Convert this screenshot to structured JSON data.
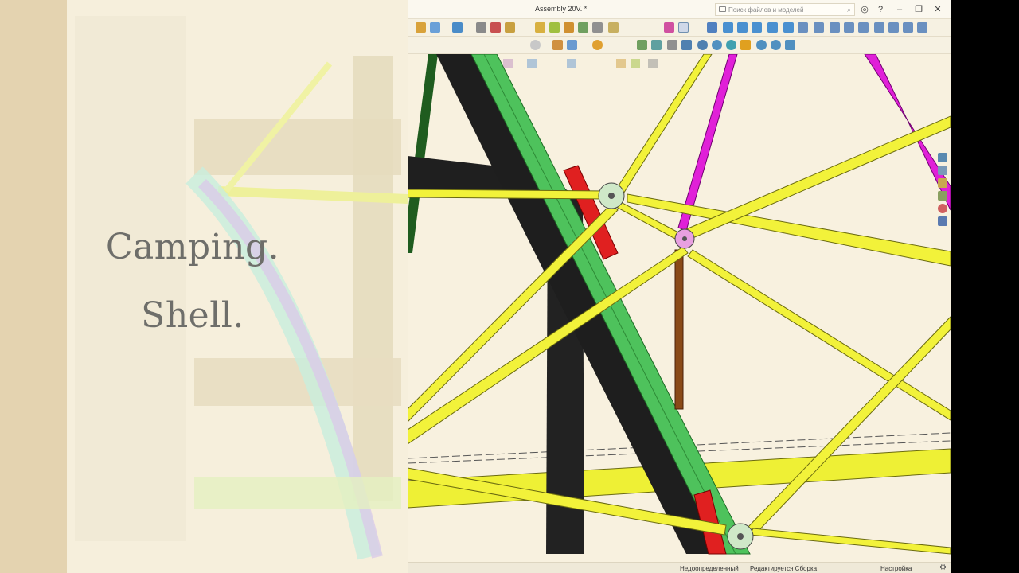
{
  "overlay": {
    "caption_line_1": "Camping.",
    "caption_line_2": "Shell."
  },
  "window": {
    "title": "Assembly 20V. *",
    "search_placeholder": "Поиск файлов и моделей",
    "controls": [
      "help",
      "minimize",
      "restore",
      "close"
    ]
  },
  "statusbar": {
    "state": "Недоопределенный",
    "mode": "Редактируется Сборка",
    "settings": "Настройка"
  },
  "colors": {
    "frame_green": "#4ec25c",
    "frame_black": "#1f1f1f",
    "strut_yellow": "#f2f23a",
    "strut_magenta": "#e020d8",
    "brace_red": "#e02020",
    "post_brown": "#8a4a18",
    "background": "#f8f1df"
  },
  "icons": {
    "toolbar1": [
      "part-icon",
      "assembly-icon",
      "sketch-icon",
      "extrude-icon",
      "revolve-icon",
      "fillet-icon",
      "chamfer-icon",
      "shell-icon",
      "mirror-icon",
      "pattern-icon",
      "measure-icon",
      "select-icon"
    ],
    "toolbar2": [
      "rotate-icon",
      "pan-icon",
      "zoom-icon",
      "view-front-icon",
      "view-top-icon",
      "shade-icon",
      "wireframe-icon",
      "color-icon"
    ],
    "right_panel": [
      "home-view-icon",
      "model-tree-icon",
      "folder-icon",
      "library-icon",
      "appearance-icon",
      "properties-icon"
    ]
  }
}
